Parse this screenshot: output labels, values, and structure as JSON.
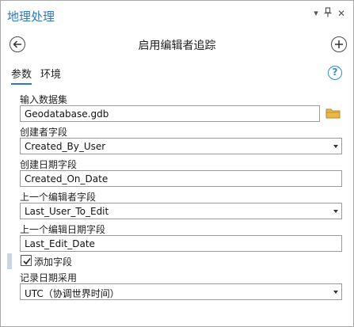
{
  "pane": {
    "title": "地理处理",
    "dropdown_glyph": "▾",
    "pin_glyph": "ㄐ",
    "close_glyph": "✕"
  },
  "tool": {
    "title": "启用编辑者追踪",
    "back_icon": "arrow-left-circle",
    "add_icon": "plus-circle"
  },
  "tabs": [
    {
      "label": "参数",
      "active": true
    },
    {
      "label": "环境",
      "active": false
    }
  ],
  "help": {
    "glyph": "?"
  },
  "params": {
    "input_dataset": {
      "label": "输入数据集",
      "value": "Geodatabase.gdb"
    },
    "creator_field": {
      "label": "创建者字段",
      "value": "Created_By_User"
    },
    "creation_date_field": {
      "label": "创建日期字段",
      "value": "Created_On_Date"
    },
    "last_editor_field": {
      "label": "上一个编辑者字段",
      "value": "Last_User_To_Edit"
    },
    "last_edit_date_field": {
      "label": "上一个编辑日期字段",
      "value": "Last_Edit_Date"
    },
    "add_fields": {
      "label": "添加字段",
      "checked": true
    },
    "time_format": {
      "label": "记录日期采用",
      "value": "UTC（协调世界时间）"
    }
  },
  "colors": {
    "accent": "#2b78c5",
    "folder": "#e8b84a",
    "checkbox_bar": "#c9d6e6"
  }
}
